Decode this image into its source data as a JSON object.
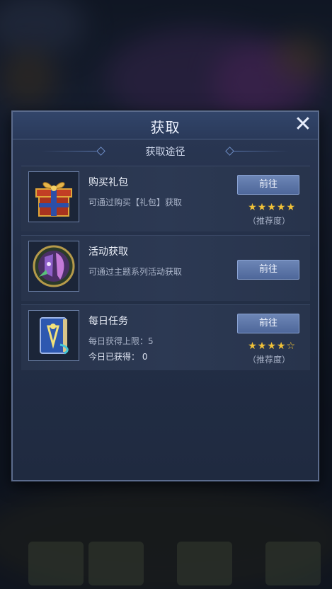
{
  "dialog": {
    "title": "获取",
    "subtitle": "获取途径"
  },
  "routes": [
    {
      "name": "购买礼包",
      "desc_lines": [
        "可通过购买【礼包】获取"
      ],
      "button": "前往",
      "stars": "★★★★★",
      "stars_filled": 5,
      "stars_max": 5,
      "rec_label": "（推荐度）",
      "icon": "gift-box-icon"
    },
    {
      "name": "活动获取",
      "desc_lines": [
        "可通过主题系列活动获取"
      ],
      "button": "前往",
      "stars": "",
      "rec_label": "",
      "icon": "hero-emblem-icon"
    },
    {
      "name": "每日任务",
      "desc_lines": [
        "每日获得上限：5",
        "今日已获得： 0"
      ],
      "button": "前往",
      "stars": "★★★★☆",
      "stars_filled": 4,
      "stars_max": 5,
      "rec_label": "（推荐度）",
      "icon": "quest-book-icon"
    }
  ],
  "colors": {
    "accent_button": "#5a73a6",
    "star": "#f1c238",
    "panel": "#243048"
  }
}
